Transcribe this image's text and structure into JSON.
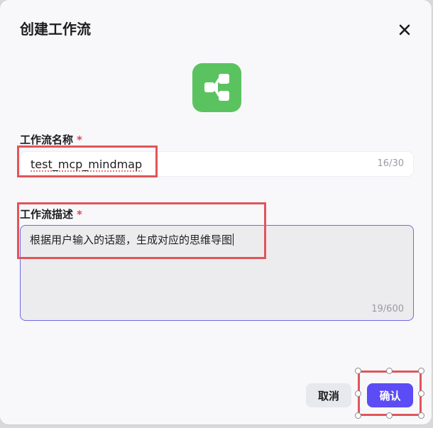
{
  "dialog": {
    "title": "创建工作流",
    "close_icon": "close-icon",
    "app_icon": "workflow-icon",
    "app_icon_color": "#5ac35f"
  },
  "name_field": {
    "label": "工作流名称",
    "required_mark": "*",
    "value": "test_mcp_mindmap",
    "counter": "16/30"
  },
  "desc_field": {
    "label": "工作流描述",
    "required_mark": "*",
    "value": "根据用户输入的话题，生成对应的思维导图",
    "counter": "19/600"
  },
  "footer": {
    "cancel_label": "取消",
    "confirm_label": "确认"
  },
  "colors": {
    "accent": "#5b4cf5",
    "required": "#e5484d",
    "highlight": "#e0555a"
  }
}
